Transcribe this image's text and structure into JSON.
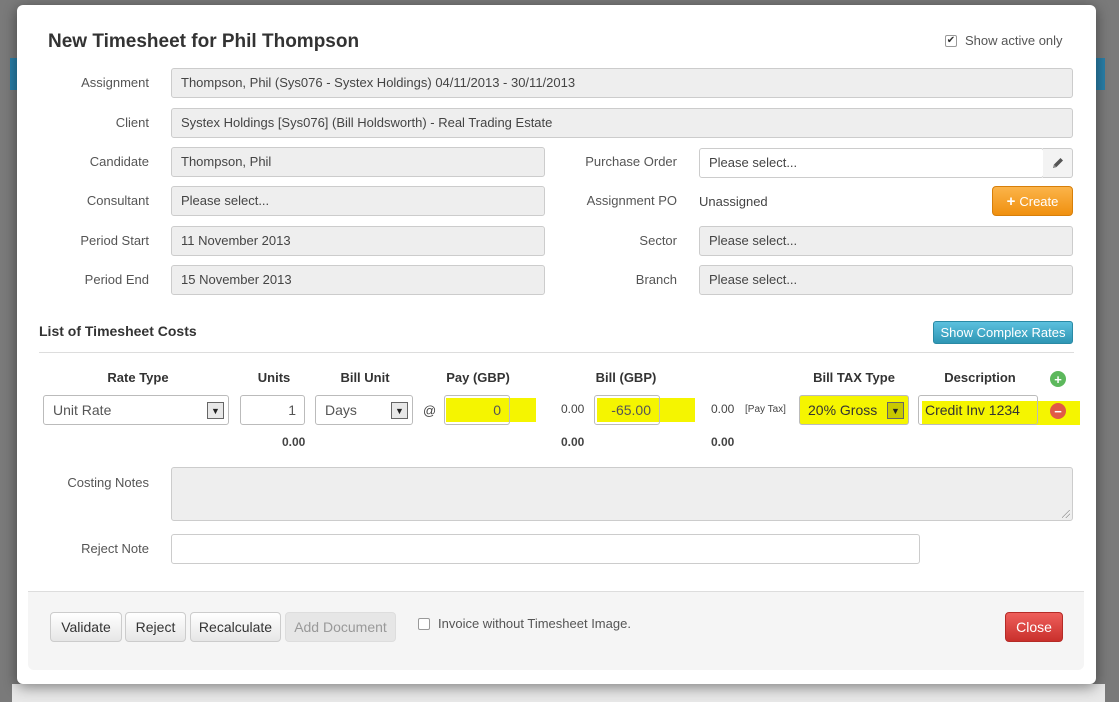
{
  "dialog": {
    "title": "New Timesheet for Phil Thompson",
    "show_active_only": {
      "label": "Show active only",
      "checked": true
    }
  },
  "form": {
    "assignment": {
      "label": "Assignment",
      "value": "Thompson, Phil (Sys076 - Systex Holdings) 04/11/2013 - 30/11/2013"
    },
    "client": {
      "label": "Client",
      "value": "Systex Holdings [Sys076] (Bill Holdsworth) - Real Trading Estate"
    },
    "candidate": {
      "label": "Candidate",
      "value": "Thompson, Phil"
    },
    "consultant": {
      "label": "Consultant",
      "value": "Please select..."
    },
    "period_start": {
      "label": "Period Start",
      "value": "11 November 2013"
    },
    "period_end": {
      "label": "Period End",
      "value": "15 November 2013"
    },
    "purchase_order": {
      "label": "Purchase Order",
      "value": "Please select..."
    },
    "assignment_po": {
      "label": "Assignment PO",
      "value": "Unassigned"
    },
    "create_button": "Create",
    "sector": {
      "label": "Sector",
      "value": "Please select..."
    },
    "branch": {
      "label": "Branch",
      "value": "Please select..."
    }
  },
  "costs": {
    "section_title": "List of Timesheet Costs",
    "complex_rates_button": "Show Complex Rates",
    "headers": {
      "rate_type": "Rate Type",
      "units": "Units",
      "bill_unit": "Bill Unit",
      "pay": "Pay (GBP)",
      "bill": "Bill (GBP)",
      "bill_tax_type": "Bill TAX Type",
      "description": "Description"
    },
    "row": {
      "rate_type": "Unit Rate",
      "units": "1",
      "bill_unit": "Days",
      "at": "@",
      "pay": "0",
      "pay_calc": "0.00",
      "bill": "-65.00",
      "bill_calc": "0.00",
      "pay_tax_label": "[Pay Tax]",
      "bill_tax_type": "20% Gross",
      "description": "Credit Inv 1234"
    },
    "totals": {
      "units": "0.00",
      "pay": "0.00",
      "bill": "0.00"
    },
    "highlight_color": "#f5f500"
  },
  "notes": {
    "costing_notes_label": "Costing Notes",
    "reject_note_label": "Reject Note"
  },
  "footer": {
    "validate": "Validate",
    "reject": "Reject",
    "recalculate": "Recalculate",
    "add_document": "Add Document",
    "invoice_without_image": {
      "label": "Invoice without Timesheet Image.",
      "checked": false
    },
    "close": "Close"
  }
}
